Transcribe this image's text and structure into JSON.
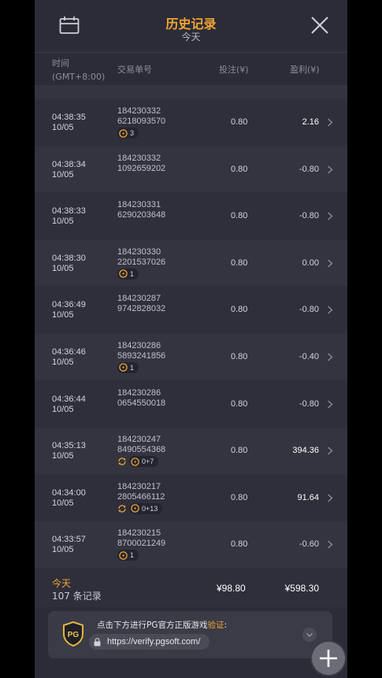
{
  "header": {
    "title": "历史记录",
    "subtitle": "今天"
  },
  "columns": {
    "time": "时间",
    "timezone": "(GMT+8:00)",
    "order": "交易单号",
    "bet": "投注(¥)",
    "profit": "盈利(¥)"
  },
  "rows": [
    {
      "time": "04:38:35",
      "date": "10/05",
      "order1": "184230332",
      "order2": "6218093570",
      "bet": "0.80",
      "profit": "2.16",
      "badge": "3",
      "recycle": false
    },
    {
      "time": "04:38:34",
      "date": "10/05",
      "order1": "184230332",
      "order2": "1092659202",
      "bet": "0.80",
      "profit": "-0.80",
      "badge": "",
      "recycle": false
    },
    {
      "time": "04:38:33",
      "date": "10/05",
      "order1": "184230331",
      "order2": "6290203648",
      "bet": "0.80",
      "profit": "-0.80",
      "badge": "",
      "recycle": false
    },
    {
      "time": "04:38:30",
      "date": "10/05",
      "order1": "184230330",
      "order2": "2201537026",
      "bet": "0.80",
      "profit": "0.00",
      "badge": "1",
      "recycle": false
    },
    {
      "time": "04:36:49",
      "date": "10/05",
      "order1": "184230287",
      "order2": "9742828032",
      "bet": "0.80",
      "profit": "-0.80",
      "badge": "",
      "recycle": false
    },
    {
      "time": "04:36:46",
      "date": "10/05",
      "order1": "184230286",
      "order2": "5893241856",
      "bet": "0.80",
      "profit": "-0.40",
      "badge": "1",
      "recycle": false
    },
    {
      "time": "04:36:44",
      "date": "10/05",
      "order1": "184230286",
      "order2": "0654550018",
      "bet": "0.80",
      "profit": "-0.80",
      "badge": "",
      "recycle": false
    },
    {
      "time": "04:35:13",
      "date": "10/05",
      "order1": "184230247",
      "order2": "8490554368",
      "bet": "0.80",
      "profit": "394.36",
      "badge": "0+7",
      "recycle": true
    },
    {
      "time": "04:34:00",
      "date": "10/05",
      "order1": "184230217",
      "order2": "2805466112",
      "bet": "0.80",
      "profit": "91.64",
      "badge": "0+13",
      "recycle": true
    },
    {
      "time": "04:33:57",
      "date": "10/05",
      "order1": "184230215",
      "order2": "8700021249",
      "bet": "0.80",
      "profit": "-0.60",
      "badge": "1",
      "recycle": false
    }
  ],
  "summary": {
    "today": "今天",
    "count": "107 条记录",
    "total_bet": "¥98.80",
    "total_profit": "¥598.30"
  },
  "verify": {
    "text": "点击下方进行PG官方正版游戏",
    "highlight": "验证",
    "colon": ":",
    "logo": "PG",
    "url": "https://verify.pgsoft.com/"
  },
  "colors": {
    "accent": "#f2a533",
    "panel": "#2b2c37",
    "row_alt": "#33343f"
  }
}
